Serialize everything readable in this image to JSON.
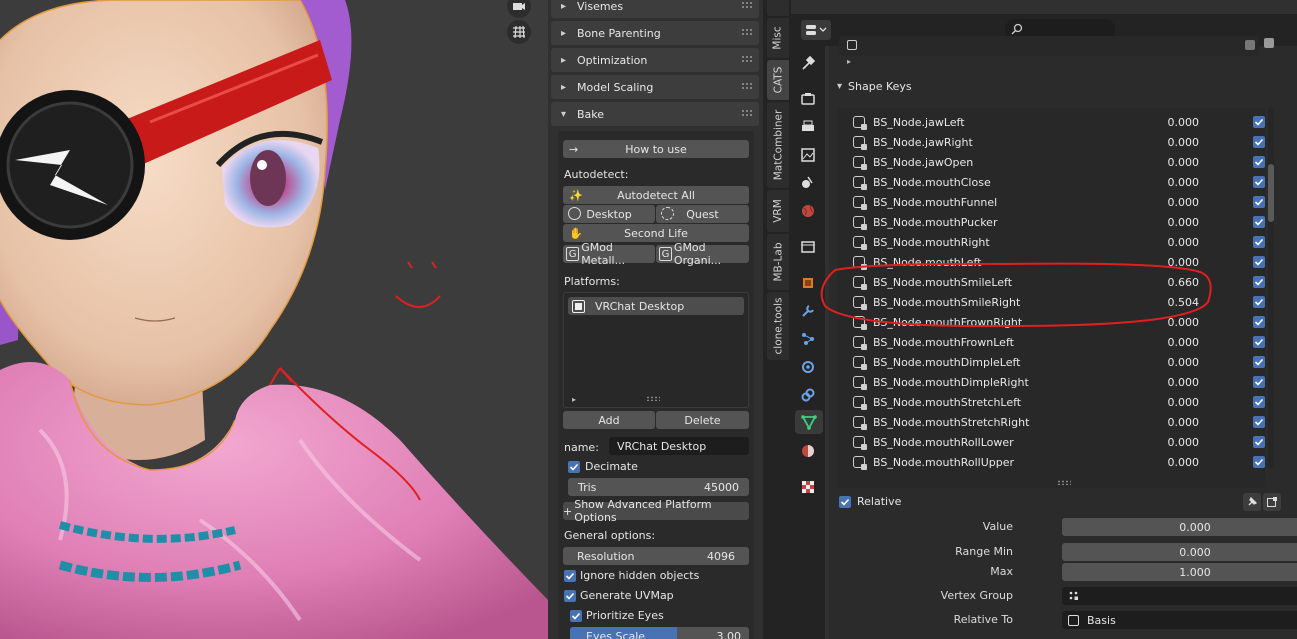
{
  "colors": {
    "accent": "#4772b3",
    "annotation": "#e02020",
    "panel": "#303030",
    "header": "#3d3d3d"
  },
  "viewport": {
    "tools": [
      "camera-icon",
      "grid-icon"
    ],
    "annotation": "red hand-drawn circle and arrow"
  },
  "cats": {
    "sections": [
      {
        "label": "Visemes"
      },
      {
        "label": "Bone Parenting"
      },
      {
        "label": "Optimization"
      },
      {
        "label": "Model Scaling"
      }
    ],
    "bake": {
      "label": "Bake",
      "how_to_use": "How to use",
      "autodetect_label": "Autodetect:",
      "autodetect_all": "Autodetect All",
      "desktop": "Desktop",
      "quest": "Quest",
      "second_life": "Second Life",
      "gmod_metal": "GMod Metall...",
      "gmod_organic": "GMod Organi...",
      "platforms_label": "Platforms:",
      "platform_item": "VRChat Desktop",
      "add": "Add",
      "delete": "Delete",
      "name_label": "name:",
      "name_value": "VRChat Desktop",
      "decimate": "Decimate",
      "tris_label": "Tris",
      "tris_value": "45000",
      "show_advanced": "Show Advanced Platform Options",
      "general_label": "General options:",
      "resolution_label": "Resolution",
      "resolution_value": "4096",
      "ignore_hidden": "Ignore hidden objects",
      "generate_uvmap": "Generate UVMap",
      "prioritize_eyes": "Prioritize Eyes",
      "eyes_scale_label": "Eyes Scale",
      "eyes_scale_value": "3.00",
      "eyes_scale_fill": 0.6
    }
  },
  "tabs": [
    "Misc",
    "CATS",
    "MatCombiner",
    "VRM",
    "MB-Lab",
    "clone.tools"
  ],
  "properties": {
    "search_placeholder": "",
    "shape_keys_title": "Shape Keys",
    "shape_keys": [
      {
        "name": "BS_Node.jawLeft",
        "value": "0.000"
      },
      {
        "name": "BS_Node.jawRight",
        "value": "0.000"
      },
      {
        "name": "BS_Node.jawOpen",
        "value": "0.000"
      },
      {
        "name": "BS_Node.mouthClose",
        "value": "0.000"
      },
      {
        "name": "BS_Node.mouthFunnel",
        "value": "0.000"
      },
      {
        "name": "BS_Node.mouthPucker",
        "value": "0.000"
      },
      {
        "name": "BS_Node.mouthRight",
        "value": "0.000"
      },
      {
        "name": "BS_Node.mouthLeft",
        "value": "0.000"
      },
      {
        "name": "BS_Node.mouthSmileLeft",
        "value": "0.660"
      },
      {
        "name": "BS_Node.mouthSmileRight",
        "value": "0.504"
      },
      {
        "name": "BS_Node.mouthFrownRight",
        "value": "0.000"
      },
      {
        "name": "BS_Node.mouthFrownLeft",
        "value": "0.000"
      },
      {
        "name": "BS_Node.mouthDimpleLeft",
        "value": "0.000"
      },
      {
        "name": "BS_Node.mouthDimpleRight",
        "value": "0.000"
      },
      {
        "name": "BS_Node.mouthStretchLeft",
        "value": "0.000"
      },
      {
        "name": "BS_Node.mouthStretchRight",
        "value": "0.000"
      },
      {
        "name": "BS_Node.mouthRollLower",
        "value": "0.000"
      },
      {
        "name": "BS_Node.mouthRollUpper",
        "value": "0.000"
      }
    ],
    "relative_label": "Relative",
    "value_label": "Value",
    "value": "0.000",
    "range_min_label": "Range Min",
    "range_min": "0.000",
    "max_label": "Max",
    "max": "1.000",
    "vertex_group_label": "Vertex Group",
    "vertex_group": "",
    "relative_to_label": "Relative To",
    "relative_to": "Basis"
  }
}
